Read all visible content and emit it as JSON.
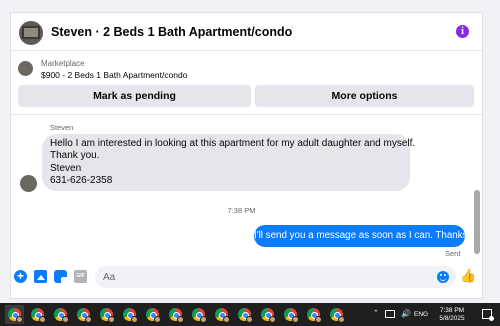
{
  "chat": {
    "title": "Steven · 2 Beds 1 Bath Apartment/condo",
    "marketplace": {
      "kicker": "Marketplace",
      "listing": "$900 - 2 Beds 1 Bath Apartment/condo"
    },
    "actions": {
      "pending": "Mark as pending",
      "more": "More options"
    },
    "incoming": {
      "sender": "Steven",
      "lines": [
        "Hello I am interested in looking at this apartment for my adult daughter and myself.",
        "Thank you.",
        "Steven",
        "631-626-2358"
      ]
    },
    "timestamp": "7:38 PM",
    "outgoing": {
      "text": "I'll send you a message as soon as I can. Thanks",
      "status": "Sent"
    },
    "composer": {
      "placeholder": "Aa"
    }
  },
  "taskbar": {
    "lang": "ENG",
    "time": "7:38 PM",
    "date": "5/8/2025"
  },
  "colors": {
    "accent": "#0a7cff",
    "info": "#8a2be2",
    "button_bg": "#e4e6eb"
  },
  "icons": [
    "info-icon",
    "plus-icon",
    "photo-icon",
    "sticker-icon",
    "gif-icon",
    "emoji-icon",
    "like-icon",
    "chrome-icon"
  ]
}
